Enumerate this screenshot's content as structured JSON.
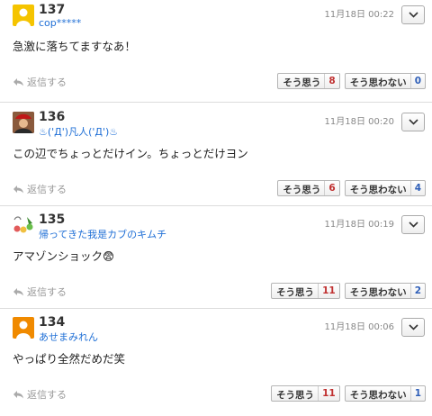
{
  "comments": [
    {
      "number": "137",
      "user": "cop*****",
      "date": "11月18日 00:22",
      "text": "急激に落ちてますなあ！",
      "reply_label": "返信する",
      "agree_label": "そう思う",
      "agree_count": "8",
      "disagree_label": "そう思わない",
      "disagree_count": "0",
      "avatar": "default-yellow-avatar"
    },
    {
      "number": "136",
      "user": "♨('Д')凡人('Д')♨",
      "date": "11月18日 00:20",
      "text": "この辺でちょっとだけイン。ちょっとだけヨン",
      "reply_label": "返信する",
      "agree_label": "そう思う",
      "agree_count": "6",
      "disagree_label": "そう思わない",
      "disagree_count": "4",
      "avatar": "photo-avatar"
    },
    {
      "number": "135",
      "user": "帰ってきた我是カブのキムチ",
      "date": "11月18日 00:19",
      "text": "アマゾンショック😨",
      "reply_label": "返信する",
      "agree_label": "そう思う",
      "agree_count": "11",
      "disagree_label": "そう思わない",
      "disagree_count": "2",
      "avatar": "illustration-avatar"
    },
    {
      "number": "134",
      "user": "あせまみれん",
      "date": "11月18日 00:06",
      "text": "やっぱり全然だめだ笑",
      "reply_label": "返信する",
      "agree_label": "そう思う",
      "agree_count": "11",
      "disagree_label": "そう思わない",
      "disagree_count": "1",
      "avatar": "default-orange-avatar"
    }
  ],
  "colors": {
    "username": "#1f6fd6",
    "agree_count": "#c03030",
    "disagree_count": "#2f5fb8",
    "avatar_yellow": "#f5c400",
    "avatar_orange": "#f08a00"
  },
  "icons": {
    "reply": "reply-arrow-icon",
    "menu": "chevron-down-icon"
  }
}
